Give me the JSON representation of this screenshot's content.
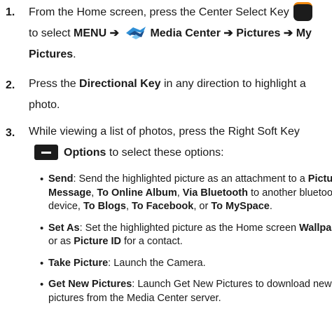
{
  "steps": [
    {
      "number": "1.",
      "line1_text": "From the Home screen, press the Center Select Key",
      "line2_a": "to select ",
      "menu": "MENU",
      "arrow": "➔",
      "media_center": "Media Center",
      "pictures": "Pictures",
      "my": "My",
      "line3": "Pictures",
      "period": "."
    },
    {
      "number": "2.",
      "a": "Press the ",
      "bold": "Directional Key",
      "b": " in any direction to highlight a",
      "c": "photo."
    },
    {
      "number": "3.",
      "line1": "While viewing a list of photos, press the Right Soft Key",
      "options": "Options",
      "rest": " to select these options:"
    }
  ],
  "bullets": [
    {
      "title": "Send",
      "line1_a": ": Send the highlighted picture as an attachment to a ",
      "picture": "Picture",
      "message": "Message",
      "sep1": ", ",
      "online": "To Online Album",
      "sep2": ", ",
      "bt": "Via Bluetooth",
      "line2_b": " to another bluetooth",
      "line3_a": "device, ",
      "blogs": "To Blogs",
      "sep3": ", ",
      "fb": "To Facebook",
      "sep4": ", or ",
      "ms": "To MySpace",
      "end": "."
    },
    {
      "title": "Set As",
      "a": ": Set the highlighted picture as the Home screen ",
      "wallpaper": "Wallpaper",
      "b": "or as ",
      "pid": "Picture ID",
      "c": " for a contact."
    },
    {
      "title": "Take Picture",
      "a": ": Launch the Camera."
    },
    {
      "title": "Get New Pictures",
      "a": ": Launch Get New Pictures to download new",
      "b": "pictures from the Media Center server."
    }
  ],
  "bullet_char": "•",
  "icons": {
    "center_key": "center-select-key-icon",
    "media_center": "media-center-icon",
    "soft_key": "right-soft-key-icon"
  },
  "colors": {
    "key_accent": "#f28a10",
    "key_body": "#1c1c1c",
    "text": "#1a1a1a"
  }
}
